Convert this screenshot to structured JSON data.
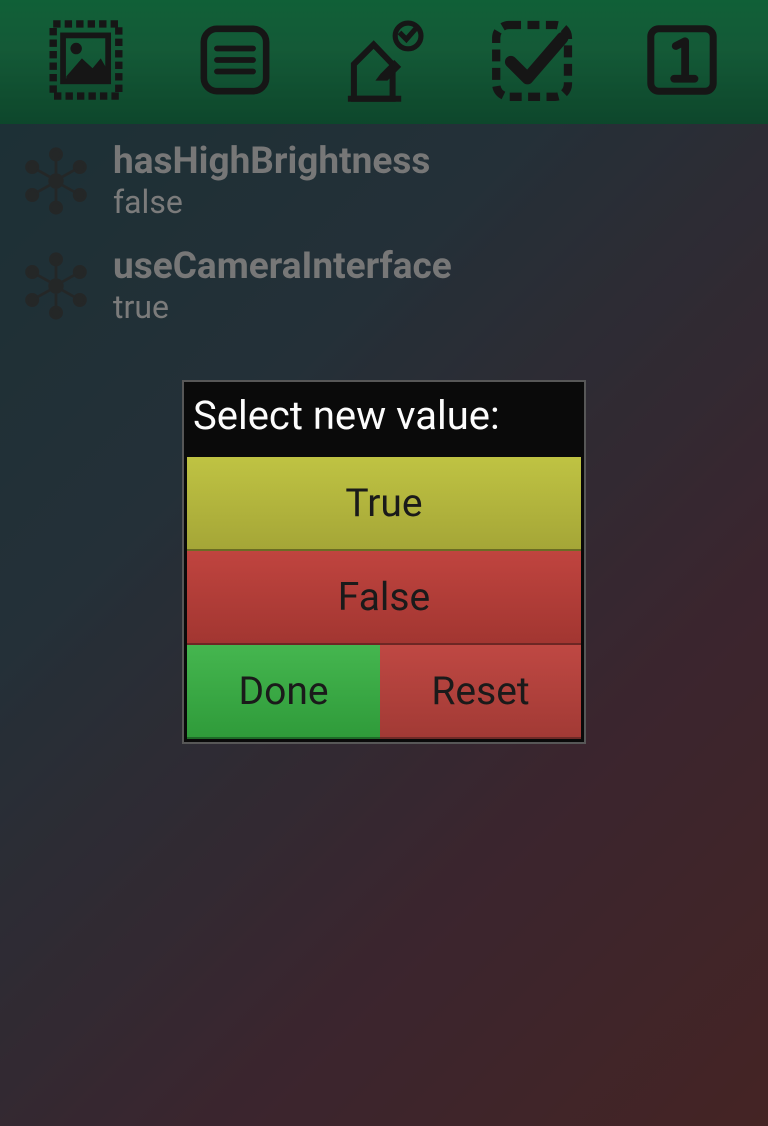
{
  "toolbar": {
    "items": [
      {
        "name": "stamp-image-icon"
      },
      {
        "name": "list-icon"
      },
      {
        "name": "rebuild-icon"
      },
      {
        "name": "checkbox-dashed-icon"
      },
      {
        "name": "number-one-box-icon"
      }
    ]
  },
  "settings": [
    {
      "key": "hasHighBrightness",
      "value": "false"
    },
    {
      "key": "useCameraInterface",
      "value": "true"
    }
  ],
  "dialog": {
    "title": "Select new value:",
    "true_label": "True",
    "false_label": "False",
    "done_label": "Done",
    "reset_label": "Reset"
  }
}
